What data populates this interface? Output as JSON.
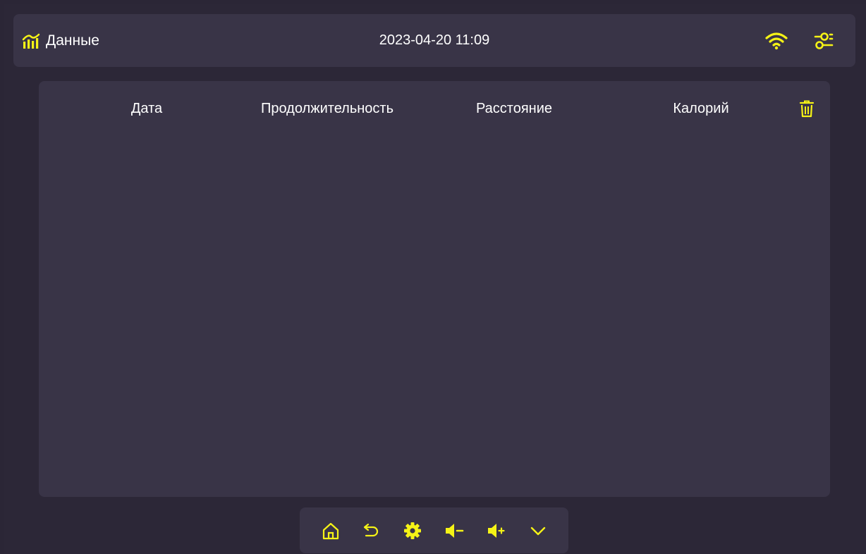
{
  "header": {
    "title": "Данные",
    "datetime": "2023-04-20 11:09",
    "icons": [
      "chart-bars-icon",
      "wifi-icon",
      "sliders-icon"
    ]
  },
  "table": {
    "columns": [
      "Дата",
      "Продолжительность",
      "Расстояние",
      "Калорий"
    ],
    "rows": [],
    "delete_icon": "trash-icon"
  },
  "bottom_bar": {
    "icons": [
      "home-icon",
      "back-icon",
      "gear-icon",
      "volume-down-icon",
      "volume-up-icon",
      "chevron-down-icon"
    ]
  },
  "colors": {
    "accent": "#f5f316",
    "background": "#2c2737",
    "panel": "#393447",
    "text": "#ffffff"
  }
}
